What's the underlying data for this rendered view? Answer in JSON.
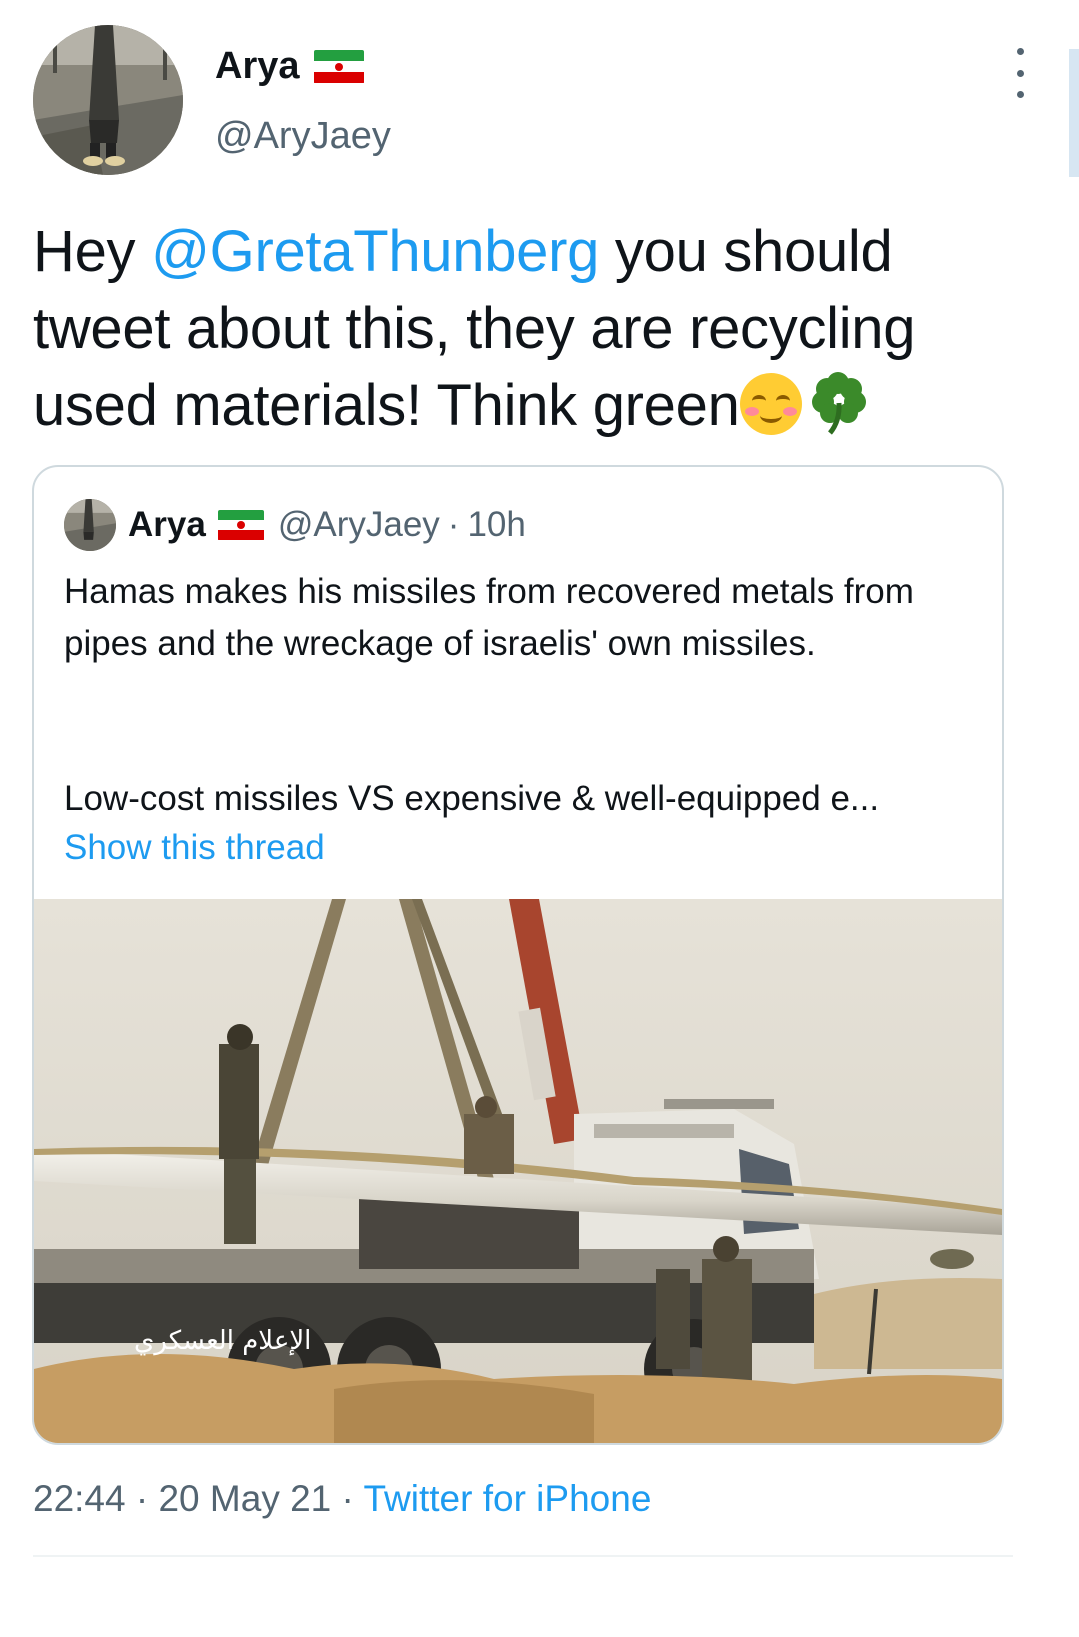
{
  "author": {
    "name": "Arya",
    "handle": "@AryJaey",
    "flag_icon": "iran-flag-icon"
  },
  "tweet": {
    "text_pre": "Hey ",
    "mention": "@GretaThunberg",
    "text_post": " you should tweet about this, they are recycling used materials! Think green",
    "emojis": [
      "smiling-face-with-smiling-eyes",
      "four-leaf-clover"
    ]
  },
  "quoted_tweet": {
    "name": "Arya",
    "handle": "@AryJaey",
    "separator": "·",
    "time": "10h",
    "paragraph1": "Hamas makes his missiles from recovered metals from pipes and the wreckage of israelis' own missiles.",
    "paragraph2": "Low-cost missiles VS expensive & well-equipped e...",
    "show_thread": "Show this thread",
    "media_watermark": "الإعلام العسكري"
  },
  "meta": {
    "time": "22:44",
    "sep1": " · ",
    "date": "20 May 21",
    "sep2": " · ",
    "source": "Twitter for iPhone"
  },
  "colors": {
    "link": "#1d9bf0",
    "text": "#0f1419",
    "secondary": "#536471",
    "border": "#cfd9de"
  }
}
